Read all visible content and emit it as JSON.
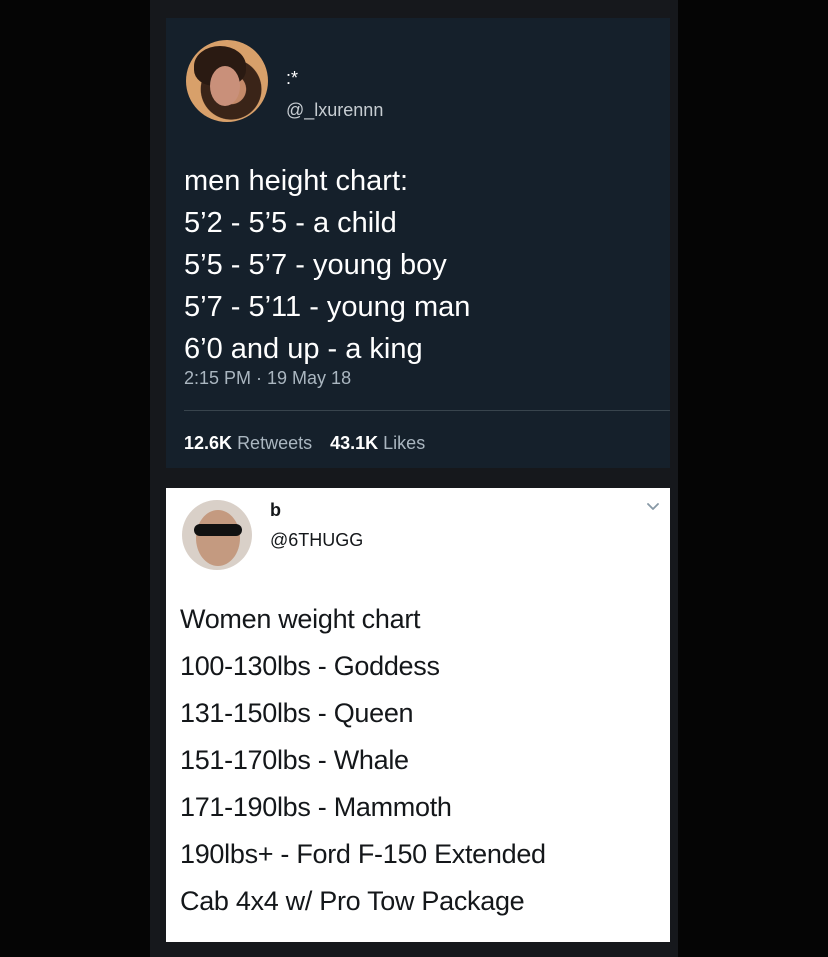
{
  "tweet_main": {
    "display_name": ":*",
    "handle": "@_lxurennn",
    "body_lines": [
      "men height chart:",
      "5’2 - 5’5 - a child",
      "5’5 - 5’7 - young boy",
      "5’7 - 5’11 - young man",
      "6’0 and up - a king"
    ],
    "timestamp": "2:15 PM · 19 May 18",
    "retweets_count": "12.6K",
    "retweets_label": "Retweets",
    "likes_count": "43.1K",
    "likes_label": "Likes",
    "avatar_icon": "profile-photo",
    "colors": {
      "background": "#15202b",
      "text": "#ffffff",
      "secondary_text": "#aab6c0"
    }
  },
  "tweet_reply": {
    "display_name": "b",
    "handle": "@6THUGG",
    "body_lines": [
      "Women weight chart",
      "100-130lbs - Goddess",
      "131-150lbs - Queen",
      "151-170lbs - Whale",
      "171-190lbs - Mammoth",
      "190lbs+  - Ford F-150 Extended",
      "Cab 4x4 w/ Pro Tow Package"
    ],
    "menu_icon": "chevron-down-icon",
    "avatar_icon": "profile-photo",
    "colors": {
      "background": "#ffffff",
      "text": "#14171a"
    }
  }
}
